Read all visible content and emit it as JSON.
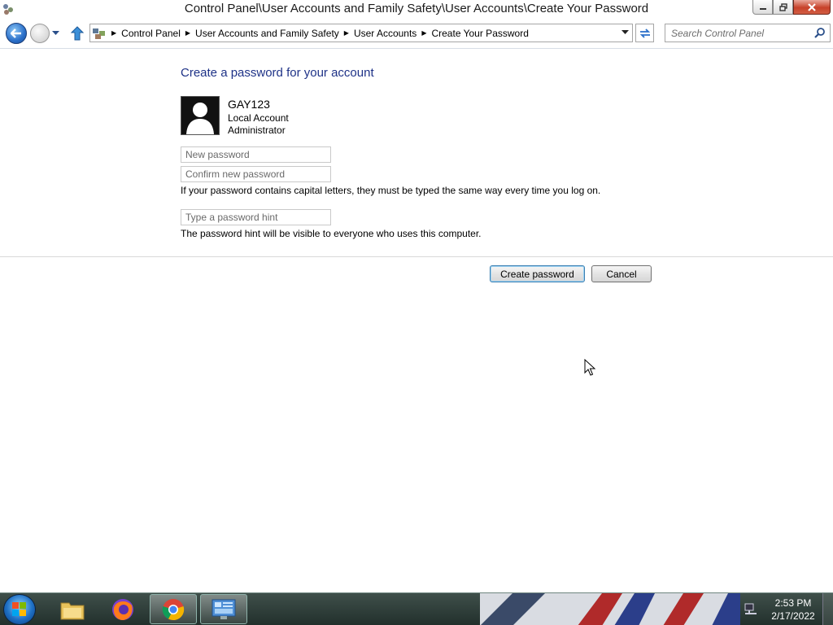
{
  "window": {
    "title": "Control Panel\\User Accounts and Family Safety\\User Accounts\\Create Your Password"
  },
  "address_bar": {
    "breadcrumbs": [
      "Control Panel",
      "User Accounts and Family Safety",
      "User Accounts",
      "Create Your Password"
    ]
  },
  "search": {
    "placeholder": "Search Control Panel"
  },
  "main": {
    "heading": "Create a password for your account",
    "user": {
      "name": "GAY123",
      "type": "Local Account",
      "role": "Administrator"
    },
    "fields": {
      "new_password_placeholder": "New password",
      "confirm_password_placeholder": "Confirm new password",
      "hint_placeholder": "Type a password hint"
    },
    "capital_letters_note": "If your password contains capital letters, they must be typed the same way every time you log on.",
    "hint_note": "The password hint will be visible to everyone who uses this computer.",
    "buttons": {
      "create": "Create password",
      "cancel": "Cancel"
    }
  },
  "taskbar": {
    "apps": [
      "Windows Explorer",
      "Firefox",
      "Google Chrome",
      "Control Panel"
    ],
    "clock": {
      "time": "2:53 PM",
      "date": "2/17/2022"
    }
  },
  "colors": {
    "heading": "#1e3287",
    "taskbar": "#2c3b37",
    "default_button_border": "#3c7fb1"
  }
}
